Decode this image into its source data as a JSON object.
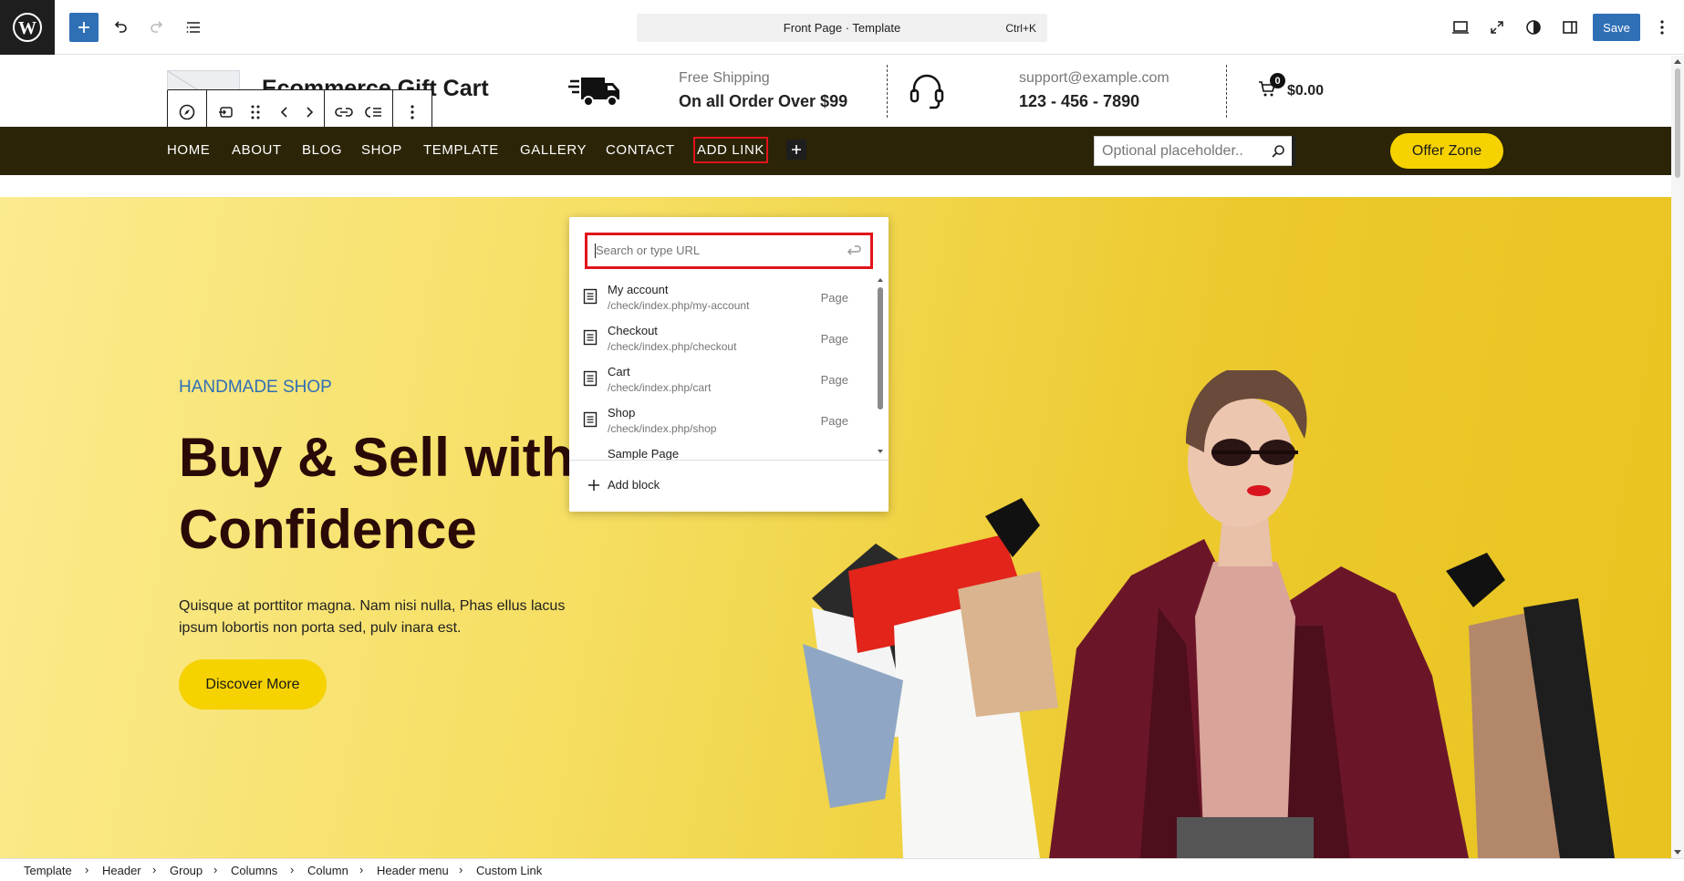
{
  "editor": {
    "command_title": "Front Page · Template",
    "command_shortcut": "Ctrl+K",
    "save_label": "Save"
  },
  "site": {
    "title": "Ecommerce Gift Cart",
    "shipping_label": "Free Shipping",
    "shipping_value": "On all Order Over $99",
    "support_email": "support@example.com",
    "support_phone": "123 - 456 - 7890",
    "cart_count": "0",
    "cart_total": "$0.00"
  },
  "nav": {
    "items": [
      "HOME",
      "ABOUT",
      "BLOG",
      "SHOP",
      "TEMPLATE",
      "GALLERY",
      "CONTACT"
    ],
    "add_link": "ADD LINK",
    "search_placeholder": "Optional placeholder..",
    "offer_label": "Offer Zone"
  },
  "hero": {
    "kicker": "HANDMADE SHOP",
    "title": "Buy & Sell with Confidence",
    "text": "Quisque at porttitor magna. Nam nisi nulla, Phas ellus lacus ipsum lobortis non porta sed, pulv inara est.",
    "button": "Discover More"
  },
  "link_popover": {
    "placeholder": "Search or type URL",
    "suggestions": [
      {
        "title": "My account",
        "url": "/check/index.php/my-account",
        "type": "Page"
      },
      {
        "title": "Checkout",
        "url": "/check/index.php/checkout",
        "type": "Page"
      },
      {
        "title": "Cart",
        "url": "/check/index.php/cart",
        "type": "Page"
      },
      {
        "title": "Shop",
        "url": "/check/index.php/shop",
        "type": "Page"
      },
      {
        "title": "Sample Page",
        "url": "",
        "type": ""
      }
    ],
    "add_block": "Add block"
  },
  "breadcrumbs": [
    "Template",
    "Header",
    "Group",
    "Columns",
    "Column",
    "Header menu",
    "Custom Link"
  ],
  "colors": {
    "accent": "#2f6fb5",
    "nav_bg": "#2b2407",
    "highlight": "#e1141b",
    "button_yellow": "#f5d200"
  }
}
